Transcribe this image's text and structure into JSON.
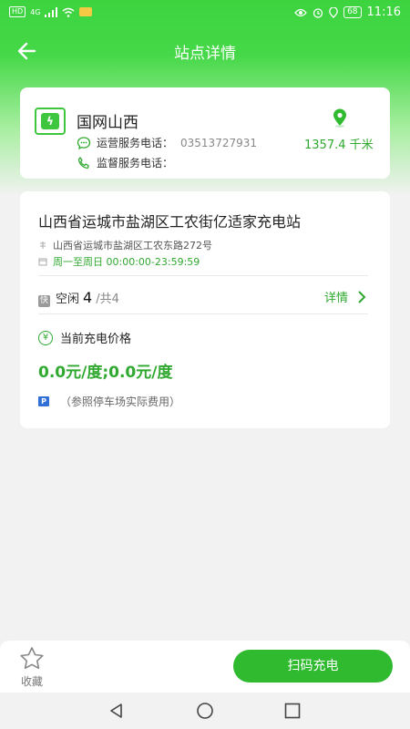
{
  "status_bar": {
    "left_chip": "HD",
    "network": "4G",
    "battery": "68",
    "time": "11:16"
  },
  "nav": {
    "title": "站点详情"
  },
  "operator": {
    "name": "国网山西",
    "ops_phone_label": "运营服务电话：",
    "ops_phone": "03513727931",
    "supervise_phone_label": "监督服务电话：",
    "distance": "1357.4 千米"
  },
  "station": {
    "name": "山西省运城市盐湖区工农街亿适家充电站",
    "address": "山西省运城市盐湖区工农东路272号",
    "hours": "周一至周日 00:00:00-23:59:59",
    "fast_badge": "快",
    "idle_label": "空闲",
    "idle_count": "4",
    "total": "/共4",
    "detail_label": "详情",
    "price_label": "当前充电价格",
    "price": "0.0元/度;0.0元/度",
    "parking_note": "（参照停车场实际费用）"
  },
  "bottom": {
    "favorite_label": "收藏",
    "scan_label": "扫码充电"
  },
  "colors": {
    "brand_green": "#2fba2f",
    "text_green": "#2fa92f",
    "parking_blue": "#2f6fd6"
  }
}
